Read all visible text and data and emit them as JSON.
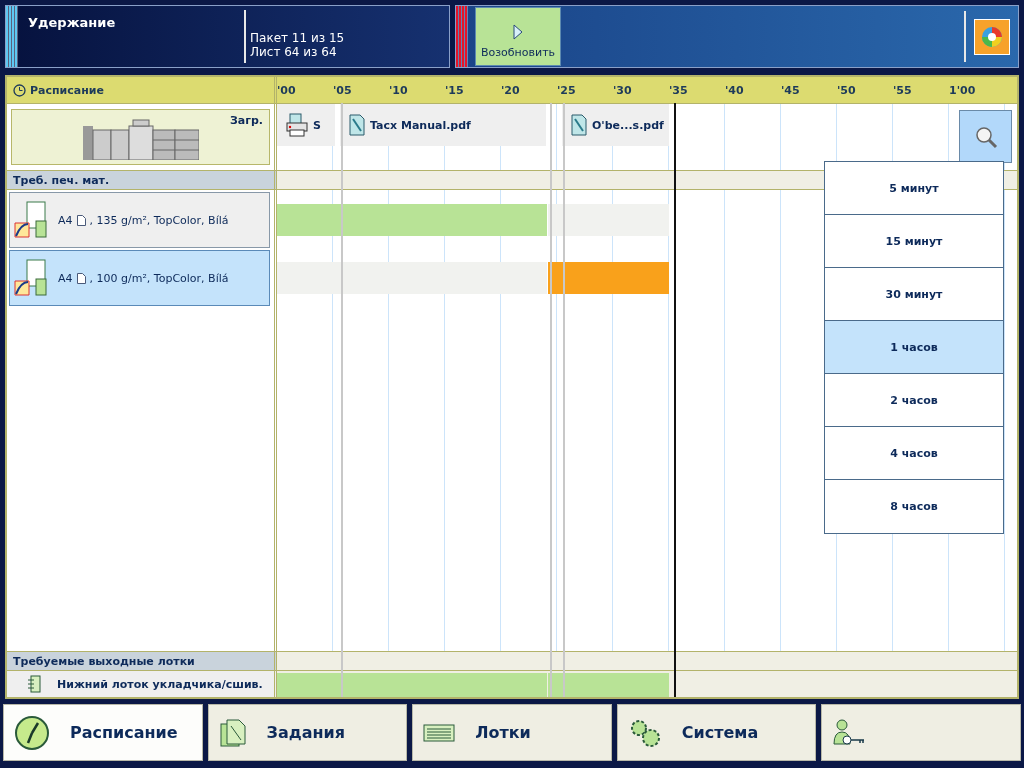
{
  "status": {
    "title": "Удержание",
    "lines": [
      "Пакет 11 из 15",
      "Лист 64 из 64"
    ],
    "resume_button": "Возобновить"
  },
  "schedule": {
    "title": "Расписание",
    "ticks": [
      "'00",
      "'05",
      "'10",
      "'15",
      "'20",
      "'25",
      "'30",
      "'35",
      "'40",
      "'45",
      "'50",
      "'55",
      "1'00"
    ],
    "machine_label": "Загр.",
    "jobs": [
      {
        "kind": "printer",
        "name": "S"
      },
      {
        "kind": "document",
        "name": "Tacx Manual.pdf"
      },
      {
        "kind": "document",
        "name": "O'be...s.pdf"
      }
    ],
    "media_section": "Треб. печ. мат.",
    "media": [
      {
        "size": "A4",
        "details": ", 135 g/m², TopColor, Bílá",
        "selected": false,
        "usage": [
          {
            "used": true,
            "color": "#b8e396"
          },
          {
            "used": true,
            "color": "#b8e396"
          },
          {
            "used": false
          }
        ]
      },
      {
        "size": "A4",
        "details": ", 100 g/m², TopColor, Bílá",
        "selected": true,
        "usage": [
          {
            "used": false
          },
          {
            "used": false
          },
          {
            "used": true,
            "color": "#f9a11b"
          }
        ]
      }
    ],
    "tray_section": "Требуемые выходные лотки",
    "trays": [
      {
        "name": "Нижний лоток укладчика/сшив.",
        "usage": [
          {
            "used": true,
            "color": "#b8e396"
          },
          {
            "used": true,
            "color": "#b8e396"
          },
          {
            "used": true,
            "color": "#b8e396"
          }
        ]
      }
    ],
    "zoom_menu": [
      {
        "label": "5 минут",
        "selected": false
      },
      {
        "label": "15 минут",
        "selected": false
      },
      {
        "label": "30 минут",
        "selected": false
      },
      {
        "label": "1 часов",
        "selected": true
      },
      {
        "label": "2 часов",
        "selected": false
      },
      {
        "label": "4 часов",
        "selected": false
      },
      {
        "label": "8 часов",
        "selected": false
      }
    ]
  },
  "tabs": [
    {
      "kind": "clock",
      "label": "Расписание",
      "selected": true
    },
    {
      "kind": "jobs",
      "label": "Задания",
      "selected": false
    },
    {
      "kind": "trays",
      "label": "Лотки",
      "selected": false
    },
    {
      "kind": "system",
      "label": "Система",
      "selected": false
    },
    {
      "kind": "user",
      "selected": false
    }
  ]
}
